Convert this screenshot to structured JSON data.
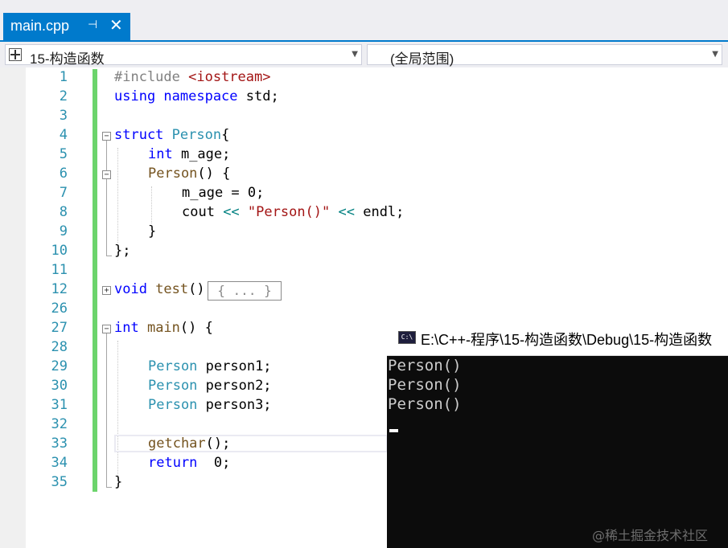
{
  "tab": {
    "title": "main.cpp",
    "pin": "⊣",
    "close": "✕"
  },
  "nav": {
    "scope_left": "15-构造函数",
    "scope_right": "(全局范围)"
  },
  "lines": [
    {
      "num": "1"
    },
    {
      "num": "2"
    },
    {
      "num": "3"
    },
    {
      "num": "4"
    },
    {
      "num": "5"
    },
    {
      "num": "6"
    },
    {
      "num": "7"
    },
    {
      "num": "8"
    },
    {
      "num": "9"
    },
    {
      "num": "10"
    },
    {
      "num": "11"
    },
    {
      "num": "12"
    },
    {
      "num": "26"
    },
    {
      "num": "27"
    },
    {
      "num": "28"
    },
    {
      "num": "29"
    },
    {
      "num": "30"
    },
    {
      "num": "31"
    },
    {
      "num": "32"
    },
    {
      "num": "33"
    },
    {
      "num": "34"
    },
    {
      "num": "35"
    }
  ],
  "code": {
    "l1_pp": "#include ",
    "l1_inc": "<iostream>",
    "l2_kw": "using namespace",
    "l2_rest": " std;",
    "l4_kw": "struct ",
    "l4_ty": "Person",
    "l4_rest": "{",
    "l5_kw": "int",
    "l5_rest": " m_age;",
    "l6_fn": "Person",
    "l6_rest": "() {",
    "l7": "m_age = 0;",
    "l8_a": "cout ",
    "l8_op1": "<<",
    "l8_str": " \"Person()\" ",
    "l8_op2": "<<",
    "l8_b": " endl;",
    "l9": "}",
    "l10": "};",
    "l12_kw": "void",
    "l12_fn": " test",
    "l12_rest": "()",
    "l12_collapsed": "{ ... }",
    "l27_kw": "int",
    "l27_fn": " main",
    "l27_rest": "() {",
    "l29_ty": "Person",
    "l29_rest": " person1;",
    "l30_ty": "Person",
    "l30_rest": " person2;",
    "l31_ty": "Person",
    "l31_rest": " person3;",
    "l33_fn": "getchar",
    "l33_rest": "();",
    "l34_kw": "return",
    "l34_rest": "  0;",
    "l35": "}"
  },
  "console": {
    "icon": "C:\\",
    "title": "E:\\C++-程序\\15-构造函数\\Debug\\15-构造函数",
    "output": [
      "Person()",
      "Person()",
      "Person()"
    ]
  },
  "watermark": "@稀土掘金技术社区",
  "colors": {
    "accent": "#007acc",
    "keyword": "#0000ff",
    "type": "#2b91af",
    "string": "#a31515",
    "gutter_changed": "#6cd46c"
  }
}
